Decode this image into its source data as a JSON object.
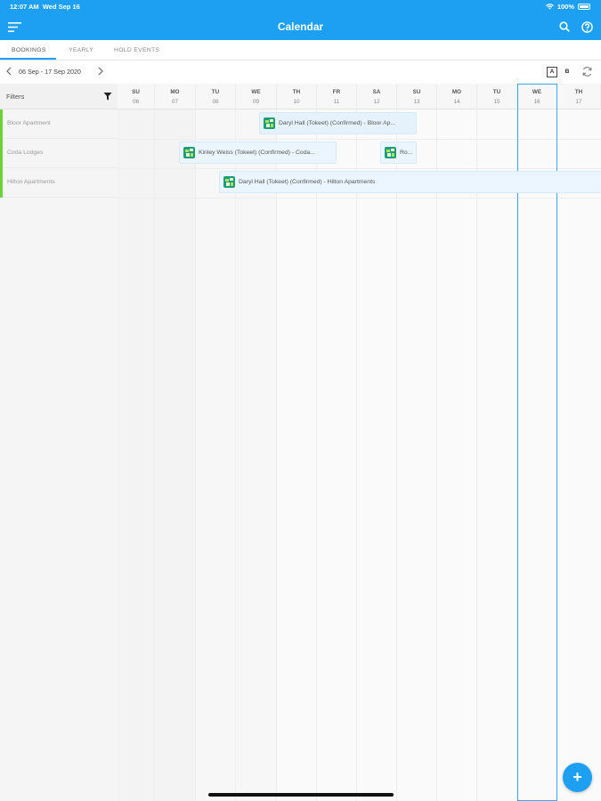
{
  "status_bar": {
    "time": "12:07 AM",
    "date": "Wed Sep 16",
    "battery": "100%"
  },
  "header": {
    "title": "Calendar",
    "menu_icon": "menu-icon",
    "search_icon": "search-icon",
    "help_icon": "help-icon"
  },
  "tabs": [
    {
      "label": "BOOKINGS",
      "active": true
    },
    {
      "label": "YEARLY",
      "active": false
    },
    {
      "label": "HOLD EVENTS",
      "active": false
    }
  ],
  "toolbar": {
    "date_range": "06 Sep - 17 Sep 2020",
    "view_a": "A",
    "view_b": "B"
  },
  "filters_label": "Filters",
  "properties": [
    "Bloor Apartment",
    "Coda Lodges",
    "Hilton Apartments"
  ],
  "days": [
    {
      "name": "SU",
      "num": "06"
    },
    {
      "name": "MO",
      "num": "07"
    },
    {
      "name": "TU",
      "num": "08"
    },
    {
      "name": "WE",
      "num": "09"
    },
    {
      "name": "TH",
      "num": "10"
    },
    {
      "name": "FR",
      "num": "11"
    },
    {
      "name": "SA",
      "num": "12"
    },
    {
      "name": "SU",
      "num": "13"
    },
    {
      "name": "MO",
      "num": "14"
    },
    {
      "name": "TU",
      "num": "15"
    },
    {
      "name": "WE",
      "num": "16"
    },
    {
      "name": "TH",
      "num": "17"
    }
  ],
  "bookings": [
    "Daryl Hall (Tokeet) (Confirmed) - Bloor Ap...",
    "Kinley Weiss (Tokeet) (Confirmed) - Coda...",
    "Ro...",
    "Daryl Hall (Tokeet) (Confirmed) - Hilton Apartments"
  ],
  "fab_label": "+",
  "colors": {
    "accent": "#1ea0f2",
    "property_bar": "#6ad33a",
    "today_border": "#3ba6f2"
  }
}
